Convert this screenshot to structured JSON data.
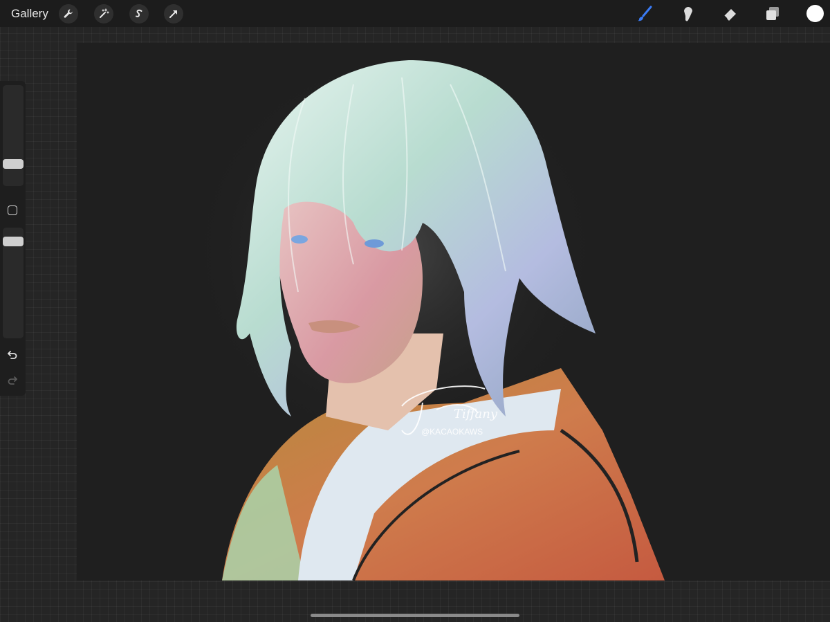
{
  "toolbar": {
    "gallery_label": "Gallery",
    "left_tools": [
      "wrench-icon",
      "magic-wand-icon",
      "selection-s-icon",
      "arrow-transform-icon"
    ],
    "right_tools": [
      "brush-icon",
      "smudge-icon",
      "eraser-icon",
      "layers-icon"
    ],
    "active_tool": "brush-icon",
    "accent_color": "#3a7bf5",
    "current_color": "#ffffff"
  },
  "sidebar": {
    "brush_size_fraction": 0.17,
    "opacity_fraction": 0.65
  },
  "artwork": {
    "signature_text": "Tiffany",
    "handle_text": "@KACAOKAWS"
  }
}
